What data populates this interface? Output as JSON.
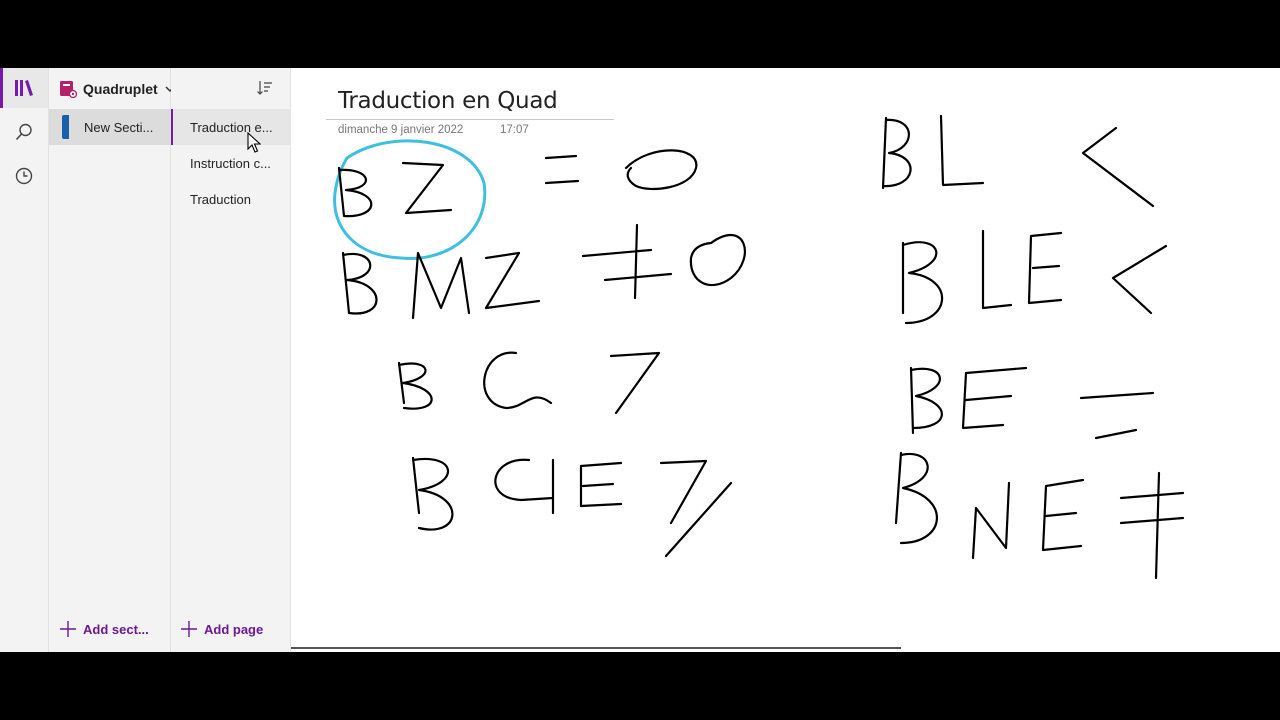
{
  "notebook": {
    "name": "Quadruplet"
  },
  "sections": {
    "items": [
      {
        "label": "New Secti..."
      }
    ],
    "add_label": "Add sect..."
  },
  "pages": {
    "items": [
      {
        "label": "Traduction e..."
      },
      {
        "label": "Instruction c..."
      },
      {
        "label": "Traduction"
      }
    ],
    "add_label": "Add page"
  },
  "page": {
    "title": "Traduction en Quad",
    "date": "dimanche 9 janvier 2022",
    "time": "17:07"
  },
  "colors": {
    "accent": "#7719aa",
    "section_tab": "#1a5fa8",
    "highlight_circle": "#3fbfe0"
  },
  "icons": [
    "notebooks-icon",
    "search-icon",
    "recent-icon",
    "notebook-icon",
    "chevron-down-icon",
    "sort-icon",
    "plus-icon"
  ]
}
